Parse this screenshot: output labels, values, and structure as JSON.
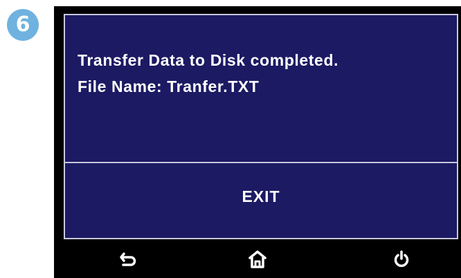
{
  "step_badge": {
    "number": "6"
  },
  "screen": {
    "message_line_1": "Transfer Data to Disk completed.",
    "message_line_2": "File Name:  Tranfer.TXT",
    "exit_label": "EXIT"
  },
  "nav_bar": {
    "icons": [
      "back-icon",
      "home-icon",
      "power-icon"
    ]
  },
  "colors": {
    "screen_background": "#1c1a63",
    "badge": "#6fb2df",
    "bezel": "#000000",
    "text": "#ffffff"
  }
}
